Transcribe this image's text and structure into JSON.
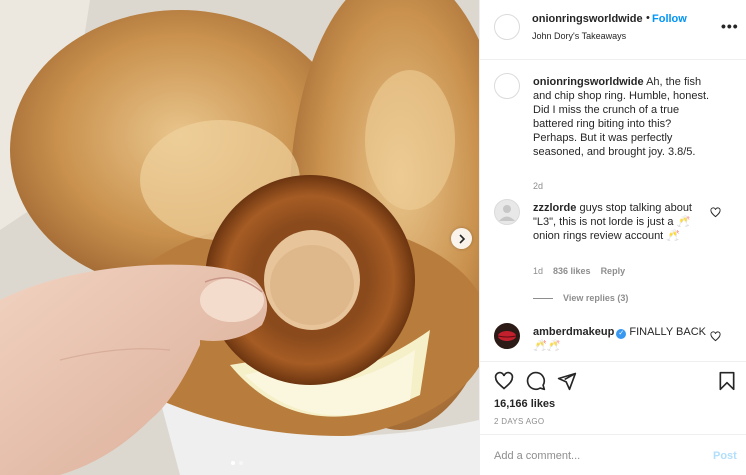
{
  "post": {
    "username": "onionringsworldwide",
    "separator": "•",
    "follow_label": "Follow",
    "location": "John Dory's Takeaways",
    "more_label": "•••"
  },
  "caption": {
    "username": "onionringsworldwide",
    "text": "Ah, the fish and chip shop ring. Humble, honest. Did I miss the crunch of a true battered ring biting into this? Perhaps. But it was perfectly seasoned, and brought joy. 3.8/5.",
    "age": "2d"
  },
  "comments": [
    {
      "username": "zzzlorde",
      "text": "guys stop talking about \"L3\", this is not lorde is just a 🥂onion rings review account 🥂",
      "age": "1d",
      "likes": "836 likes",
      "reply_label": "Reply",
      "view_replies": "View replies (3)"
    },
    {
      "username": "amberdmakeup",
      "verified": true,
      "text": "FINALLY BACK🥂🥂"
    }
  ],
  "actions": {
    "likes": "16,166 likes",
    "date": "2 DAYS AGO"
  },
  "add_comment": {
    "placeholder": "Add a comment...",
    "post_label": "Post"
  },
  "carousel": {
    "slide_count": 2,
    "active_index": 0
  }
}
